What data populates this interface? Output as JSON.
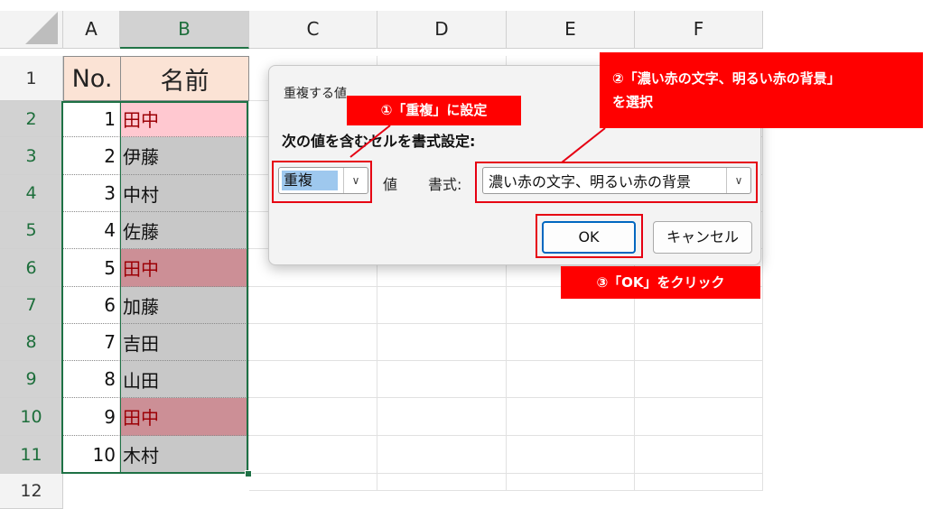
{
  "spreadsheet": {
    "columns": [
      "A",
      "B",
      "C",
      "D",
      "E",
      "F"
    ],
    "rows": [
      "1",
      "2",
      "3",
      "4",
      "5",
      "6",
      "7",
      "8",
      "9",
      "10",
      "11",
      "12"
    ],
    "header": {
      "a": "No.",
      "b": "名前"
    },
    "data": [
      {
        "no": "1",
        "name": "田中"
      },
      {
        "no": "2",
        "name": "伊藤"
      },
      {
        "no": "3",
        "name": "中村"
      },
      {
        "no": "4",
        "name": "佐藤"
      },
      {
        "no": "5",
        "name": "田中"
      },
      {
        "no": "6",
        "name": "加藤"
      },
      {
        "no": "7",
        "name": "吉田"
      },
      {
        "no": "8",
        "name": "山田"
      },
      {
        "no": "9",
        "name": "田中"
      },
      {
        "no": "10",
        "name": "木村"
      }
    ]
  },
  "dialog": {
    "title": "重複する値",
    "prompt": "次の値を含むセルを書式設定:",
    "type_value": "重複",
    "value_label": "値",
    "format_label": "書式:",
    "format_value": "濃い赤の文字、明るい赤の背景",
    "ok_label": "OK",
    "cancel_label": "キャンセル"
  },
  "callouts": {
    "step1": "①「重複」に設定",
    "step2_line1": "②「濃い赤の文字、明るい赤の背景」",
    "step2_line2": "を選択",
    "step3": "③「OK」をクリック"
  },
  "colors": {
    "selection_green": "#1e7145",
    "duplicate_text": "#9c0006",
    "duplicate_fill": "#ffc7ce",
    "callout_red": "#ff0000"
  }
}
